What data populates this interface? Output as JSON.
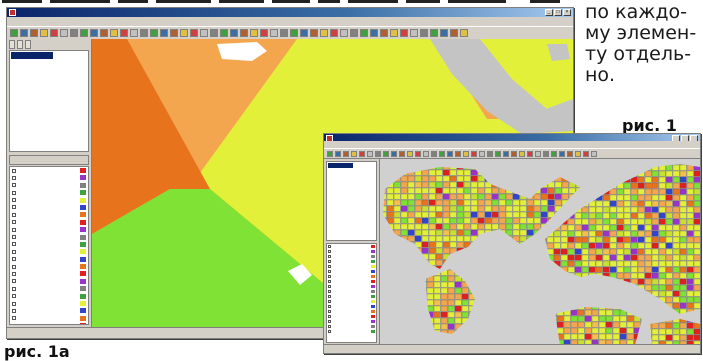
{
  "side_text": {
    "lines": [
      "по каждо-",
      "му элемен-",
      "ту отдель-",
      "но."
    ]
  },
  "captions": {
    "fig1": "рис. 1",
    "fig1a": "рис. 1а"
  },
  "colors": {
    "dark_orange": "#e8731d",
    "light_orange": "#f3a64e",
    "yellow_green": "#e3f03a",
    "green": "#7fe235",
    "gray": "#c4c4c4",
    "purple": "#9933cc",
    "blue": "#3344cc",
    "red": "#e02020"
  },
  "window_main": {
    "title": "",
    "menu": [
      "",
      "",
      "",
      "",
      "",
      "",
      "",
      "",
      ""
    ],
    "status": ""
  },
  "window_second": {
    "title": "",
    "menu": [
      "",
      "",
      "",
      "",
      "",
      "",
      "",
      ""
    ],
    "status": ""
  }
}
